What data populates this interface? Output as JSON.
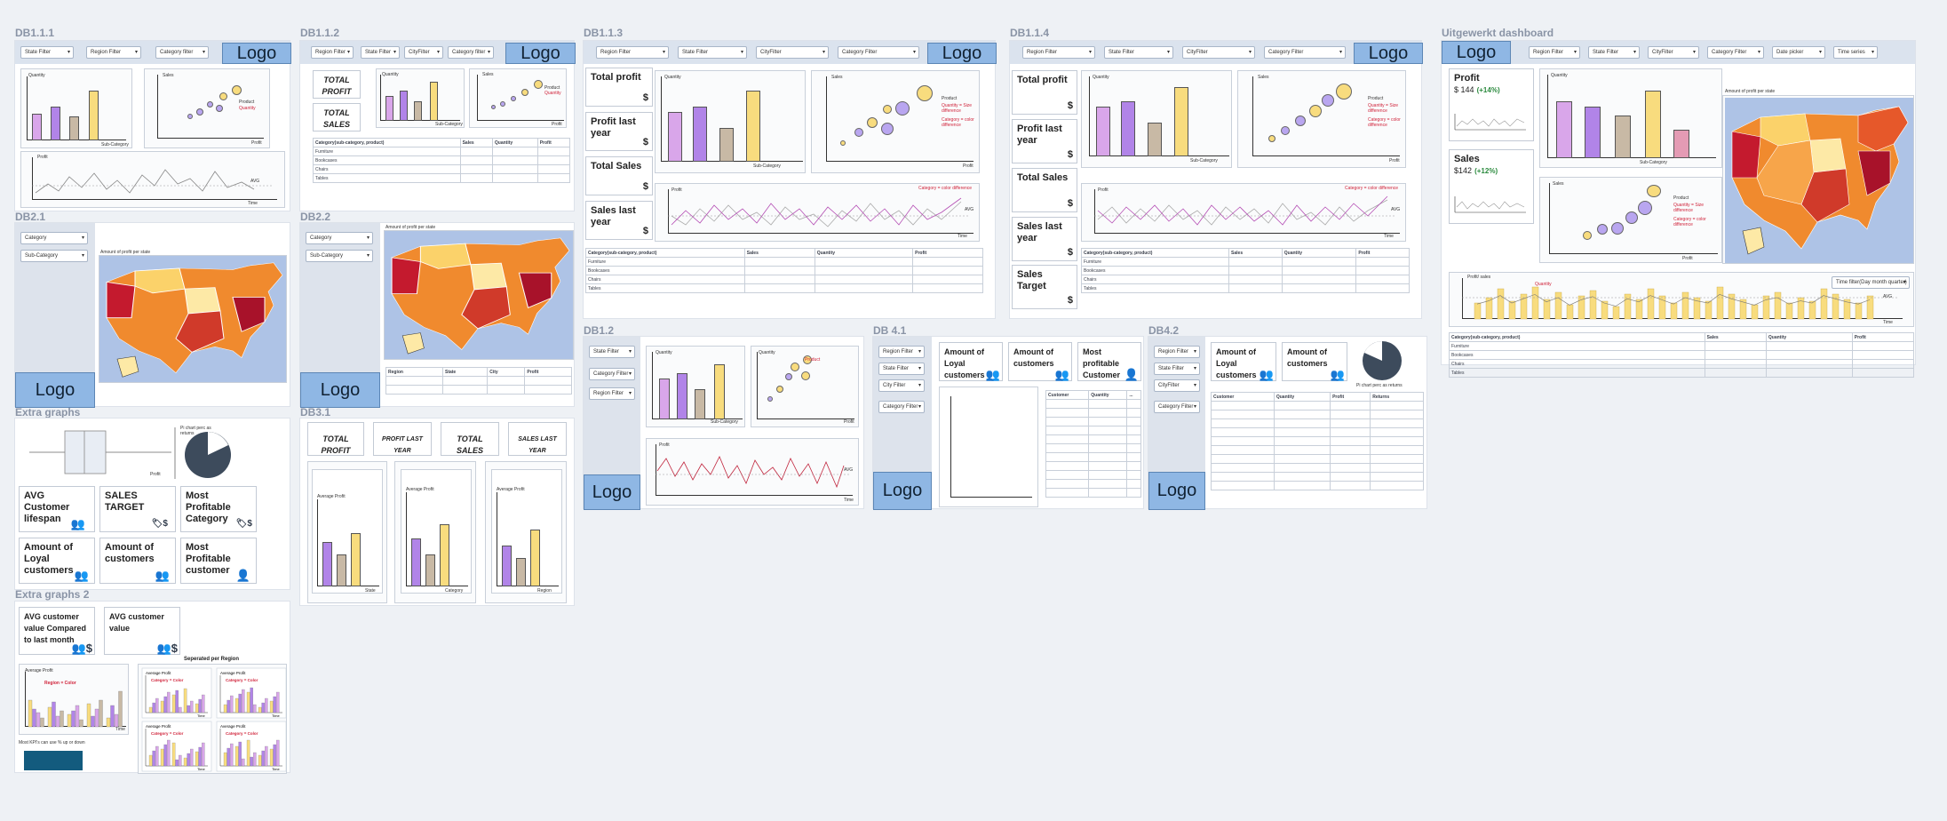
{
  "colors": {
    "purple": "#b184e8",
    "lilac": "#d9a6ea",
    "tan": "#c8b9a5",
    "yellow": "#f8dc7e",
    "magenta": "#b44db4",
    "logo": "#8fb7e4",
    "red": "#d0233a"
  },
  "boards": {
    "db111": "DB1.1.1",
    "db112": "DB1.1.2",
    "db113": "DB1.1.3",
    "db114": "DB1.1.4",
    "uitgewerkt": "Uitgewerkt dashboard",
    "db21": "DB2.1",
    "db22": "DB2.2",
    "db12": "DB1.2",
    "db41": "DB 4.1",
    "db42": "DB4.2",
    "db31": "DB3.1",
    "extra": "Extra graphs",
    "extra2": "Extra graphs 2"
  },
  "logo": "Logo",
  "filters": {
    "state": "State Filter",
    "region": "Region Filter",
    "category": "Category filter",
    "city": "CityFilter",
    "categoryF": "Category Filter",
    "cityF": "City Filter",
    "categoryC": "Category",
    "subcat": "Sub-Category",
    "date": "Date picker",
    "time": "Time series",
    "stateF": "State Filter",
    "region2": "Region Filter",
    "catfilter": "Category filter"
  },
  "labels": {
    "quantity": "Quantity",
    "sales": "Sales",
    "profit": "Profit",
    "subcategory": "Sub-Category",
    "time": "Time",
    "product": "Product",
    "avg": "AVG",
    "amount_profit_state": "Amount of profit per state",
    "state": "State",
    "category": "Category",
    "region": "Region",
    "average_profit": "Average Profit",
    "qty_size": "Quantity = Size difference",
    "cat_color": "Category = color difference",
    "cat_color2": "Category = color difference",
    "cat_eq_color": "Category = Color",
    "region_eq_color": "Region = Color",
    "separated_region": "Seperated per Region",
    "most_kpis": "Most KPI's can use % up or down",
    "pie_returns": "Pi chart perc as returns",
    "pie_returns2": "Pi chart perc as returns",
    "profit_sales": "Profit/ sales",
    "time_filter": "Time filter(Day month quarter)",
    "customer": "Customer",
    "returns": "Returns",
    "city": "City"
  },
  "kpis": {
    "total_profit": "Total profit",
    "profit_last_year": "Profit last year",
    "total_sales": "Total Sales",
    "sales_last_year": "Sales last year",
    "sales_target": "Sales Target",
    "dollar": "$",
    "TOTAL_PROFIT": "TOTAL PROFIT",
    "TOTAL_SALES": "TOTAL SALES",
    "PROFIT_LAST_YEAR": "PROFIT LAST YEAR",
    "SALES_LAST_YEAR": "SALES LAST YEAR",
    "avg_lifespan": "AVG Customer lifespan",
    "sales_target_caps": "SALES TARGET",
    "most_profitable_category": "Most Profitable Category",
    "loyal": "Amount of Loyal customers",
    "amount_customers": "Amount of customers",
    "most_profitable_customer": "Most Profitable customer",
    "most_profitable_customer2": "Most profitable Customer",
    "avg_value_cmp": "AVG customer value Compared to last month",
    "avg_value": "AVG customer value",
    "profit": "Profit",
    "profit_val": "$ 144",
    "profit_pct": "(+14%)",
    "sales": "Sales",
    "sales_val": "$142",
    "sales_pct": "(+12%)"
  },
  "table": {
    "header": [
      "Category(sub-category, product)",
      "Sales",
      "Quantity",
      "Profit"
    ],
    "rows": [
      "Furniture",
      "Bookcases",
      "Chairs",
      "Tables"
    ]
  }
}
